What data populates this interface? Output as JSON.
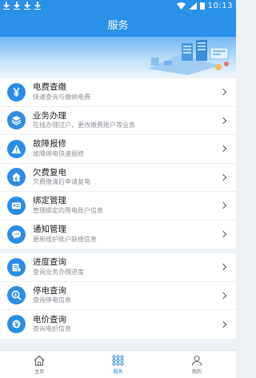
{
  "status_bar": {
    "time": "10:13"
  },
  "header": {
    "title": "服务"
  },
  "groups": [
    {
      "items": [
        {
          "title": "电费查缴",
          "subtitle": "快速查询与缴纳电费",
          "icon": "yuan-icon"
        },
        {
          "title": "业务办理",
          "subtitle": "在线办理过户、更改缴费账户等业务",
          "icon": "layers-icon"
        },
        {
          "title": "故障报修",
          "subtitle": "故障停电快速报修",
          "icon": "warning-icon"
        },
        {
          "title": "欠费复电",
          "subtitle": "欠费缴清后申请复电",
          "icon": "house-plug-icon"
        },
        {
          "title": "绑定管理",
          "subtitle": "管理绑定的用电账户信息",
          "icon": "id-card-icon"
        },
        {
          "title": "通知管理",
          "subtitle": "更新维护账户联络信息",
          "icon": "chat-icon"
        }
      ]
    },
    {
      "items": [
        {
          "title": "进度查询",
          "subtitle": "查询业务办理进度",
          "icon": "progress-icon"
        },
        {
          "title": "停电查询",
          "subtitle": "查询停电信息",
          "icon": "search-bolt-icon"
        },
        {
          "title": "电价查询",
          "subtitle": "查询电价信息",
          "icon": "price-icon"
        }
      ]
    }
  ],
  "tabbar": [
    {
      "label": "主页",
      "icon": "home-icon",
      "active": false
    },
    {
      "label": "服务",
      "icon": "grid-icon",
      "active": true
    },
    {
      "label": "我的",
      "icon": "user-icon",
      "active": false
    }
  ],
  "colors": {
    "primary": "#2a90e8",
    "icon_bg": "#2a8de6"
  }
}
